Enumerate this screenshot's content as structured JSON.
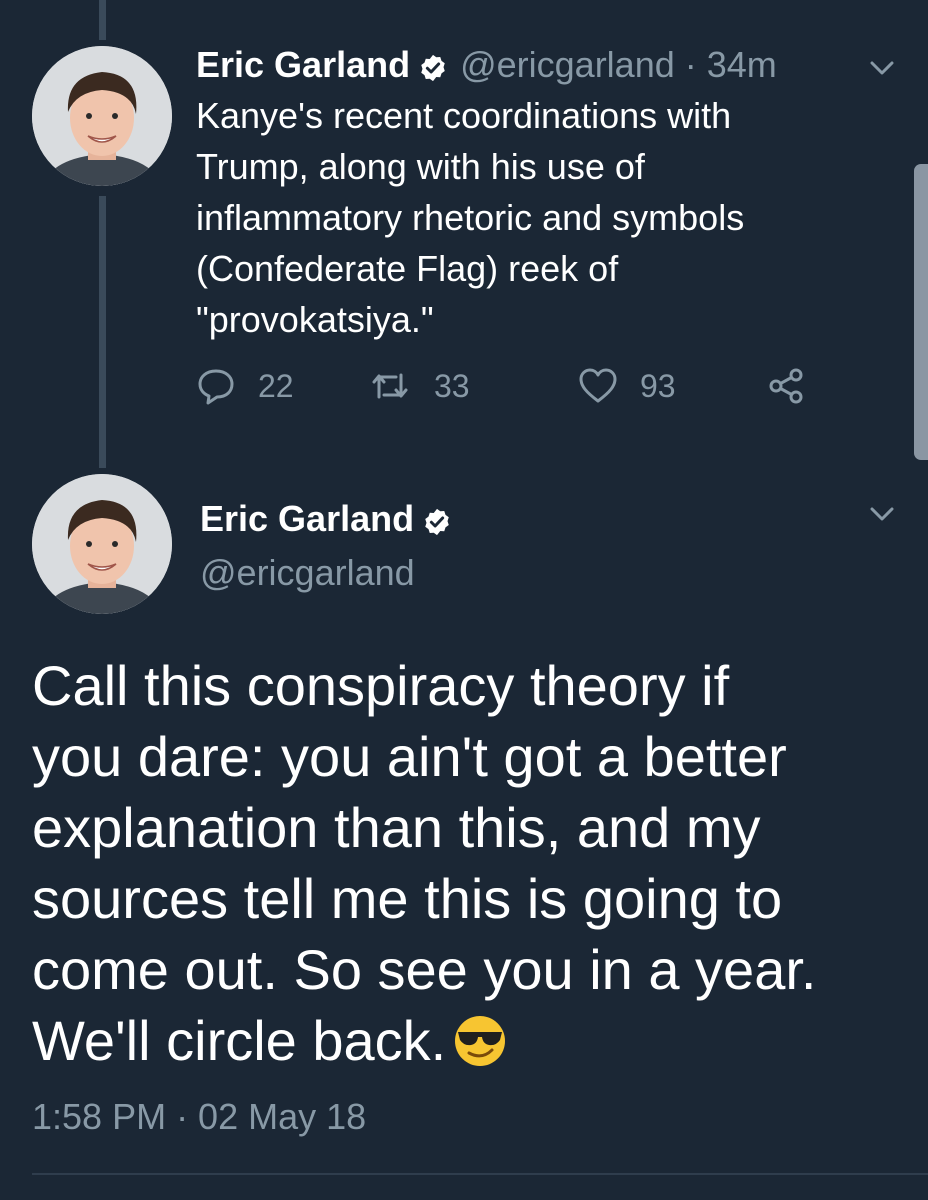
{
  "tweet1": {
    "display_name": "Eric Garland",
    "handle": "@ericgarland",
    "separator": "·",
    "time": "34m",
    "text_lines": [
      "Kanye's recent coordinations with",
      "Trump, along with his use of",
      "inflammatory rhetoric and symbols",
      "(Confederate Flag) reek of",
      "\"provokatsiya.\""
    ],
    "replies": "22",
    "retweets": "33",
    "likes": "93"
  },
  "tweet2": {
    "display_name": "Eric Garland",
    "handle": "@ericgarland",
    "text_lines": [
      "Call this conspiracy theory if",
      "you dare: you ain't got a better",
      "explanation than this, and my",
      "sources tell me this is going to",
      "come out. So see you in a year.",
      "We'll circle back."
    ],
    "emoji": "smiling-face-with-sunglasses",
    "timestamp": "1:58 PM · 02 May 18"
  },
  "icons": {
    "reply": "reply-icon",
    "retweet": "retweet-icon",
    "like": "heart-icon",
    "share": "share-icon",
    "verified": "verified-badge-icon",
    "caret": "chevron-down-icon"
  },
  "colors": {
    "background": "#1b2735",
    "muted": "#8899a6",
    "text": "#ffffff",
    "thread_line": "#3a4a5a"
  }
}
